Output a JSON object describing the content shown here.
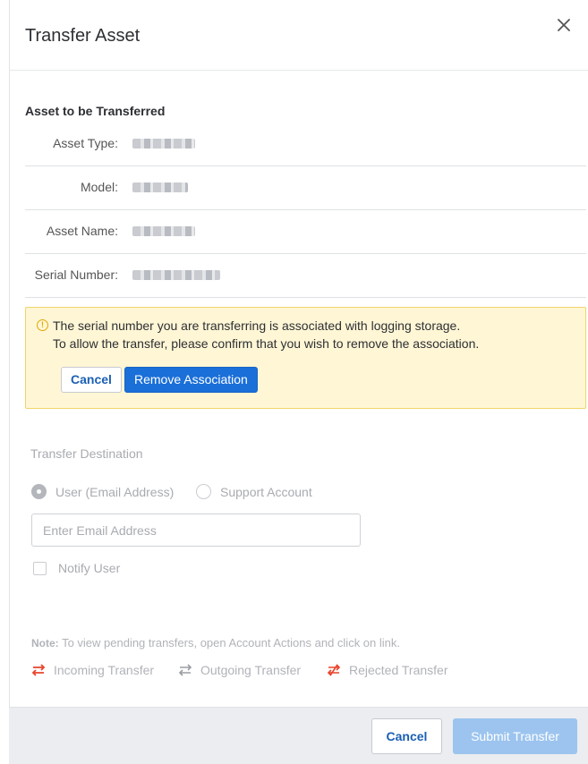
{
  "modal": {
    "title": "Transfer Asset"
  },
  "asset": {
    "section_title": "Asset to be Transferred",
    "fields": [
      {
        "label": "Asset Type:"
      },
      {
        "label": "Model:"
      },
      {
        "label": "Asset Name:"
      },
      {
        "label": "Serial Number:"
      }
    ]
  },
  "warning": {
    "line1": "The serial number you are transferring is associated with logging storage.",
    "line2": "To allow the transfer, please confirm that you wish to remove the association.",
    "cancel_label": "Cancel",
    "remove_label": "Remove Association",
    "color": "#fff6d5"
  },
  "destination": {
    "title": "Transfer Destination",
    "option_user": "User (Email Address)",
    "option_support": "Support Account",
    "selected": "User (Email Address)",
    "email_placeholder": "Enter Email Address",
    "email_value": "",
    "notify_label": "Notify User",
    "notify_checked": false
  },
  "note": {
    "label": "Note:",
    "text": "To view pending transfers, open Account Actions and click on link."
  },
  "legend": {
    "incoming": "Incoming Transfer",
    "outgoing": "Outgoing Transfer",
    "rejected": "Rejected Transfer",
    "incoming_icon": "incoming-transfer-icon",
    "outgoing_icon": "outgoing-transfer-icon",
    "rejected_icon": "rejected-transfer-icon"
  },
  "footer": {
    "cancel_label": "Cancel",
    "submit_label": "Submit Transfer",
    "accent": "#1a6fd8"
  }
}
